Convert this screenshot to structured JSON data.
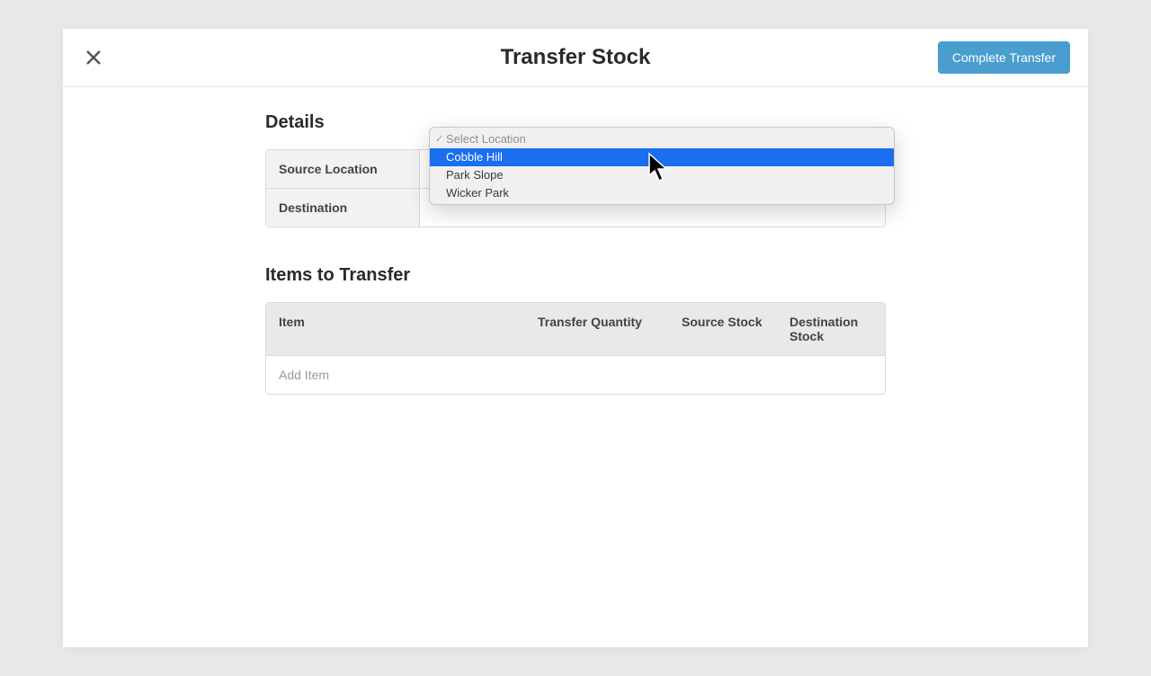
{
  "header": {
    "title": "Transfer Stock",
    "complete_label": "Complete Transfer"
  },
  "details": {
    "section_title": "Details",
    "rows": [
      {
        "label": "Source Location"
      },
      {
        "label": "Destination"
      }
    ]
  },
  "dropdown": {
    "placeholder": "Select Location",
    "options": [
      "Cobble Hill",
      "Park Slope",
      "Wicker Park"
    ],
    "highlighted_index": 0
  },
  "items_section": {
    "title": "Items to Transfer",
    "columns": {
      "item": "Item",
      "qty": "Transfer Quantity",
      "src": "Source Stock",
      "dst": "Destination Stock"
    },
    "add_item_placeholder": "Add Item"
  }
}
